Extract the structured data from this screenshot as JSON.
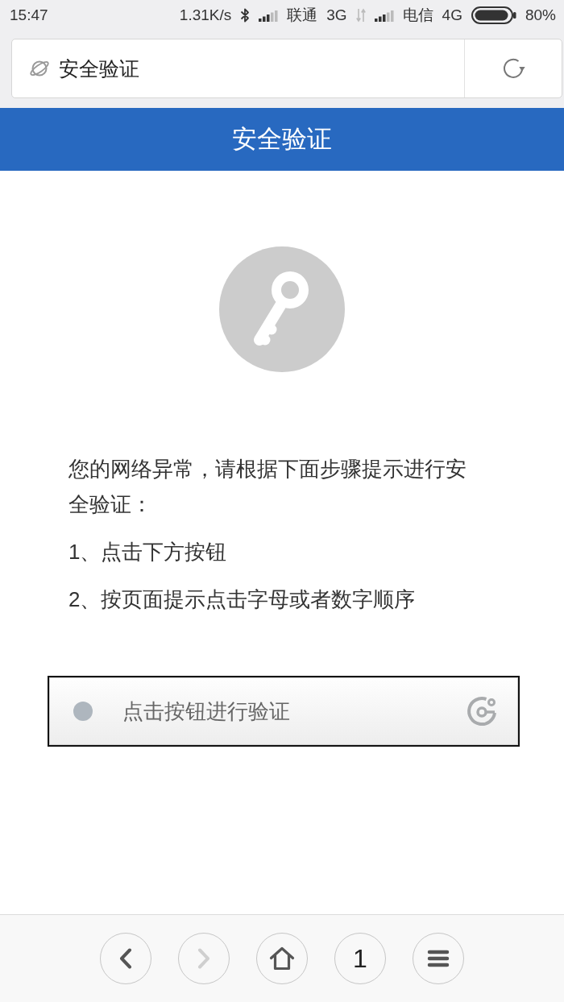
{
  "status_bar": {
    "time": "15:47",
    "speed": "1.31K/s",
    "carriers": [
      {
        "name": "联通",
        "network": "3G"
      },
      {
        "name": "电信",
        "network": "4G"
      }
    ],
    "battery": "80%"
  },
  "address_bar": {
    "title": "安全验证"
  },
  "header": {
    "title": "安全验证"
  },
  "message": {
    "intro": "您的网络异常，请根据下面步骤提示进行安全验证：",
    "steps": [
      "1、点击下方按钮",
      "2、按页面提示点击字母或者数字顺序"
    ]
  },
  "verify_button": {
    "label": "点击按钮进行验证"
  },
  "bottom_nav": [
    {
      "kind": "back",
      "disabled": false
    },
    {
      "kind": "forward",
      "disabled": true
    },
    {
      "kind": "home",
      "disabled": false
    },
    {
      "kind": "tabs",
      "label": "1",
      "disabled": false
    },
    {
      "kind": "menu",
      "disabled": false
    }
  ]
}
